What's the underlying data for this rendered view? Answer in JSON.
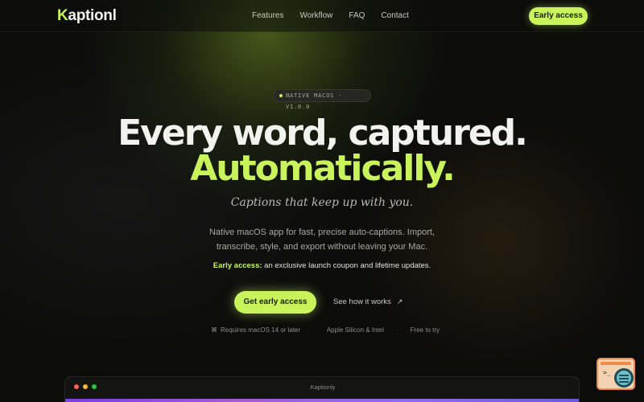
{
  "nav": {
    "logo_k": "K",
    "logo_rest": "aptionl",
    "links": [
      "Features",
      "Workflow",
      "FAQ",
      "Contact"
    ],
    "cta": "Early access"
  },
  "hero": {
    "badge": "NATIVE MACOS · V1.0.0",
    "headline_1": "Every word, captured.",
    "headline_2": "Automatically.",
    "tagline": "Captions that keep up with you.",
    "description": "Native macOS app for fast, precise auto-captions. Import, transcribe, style, and export without leaving your Mac.",
    "early_label": "Early access:",
    "early_text": " an exclusive launch coupon and lifetime updates.",
    "primary_cta": "Get early access",
    "secondary_cta": "See how it works",
    "requirements": [
      "Requires macOS 14 or later",
      "Apple Silicon & Intel",
      "Free to try"
    ]
  },
  "app_window": {
    "title": "Kaptionly"
  },
  "colors": {
    "accent": "#c8f35a",
    "background": "#0c0c0b"
  },
  "icons": {
    "secondary_cta": "arrow-up-right-icon",
    "requirements": "command-icon"
  }
}
